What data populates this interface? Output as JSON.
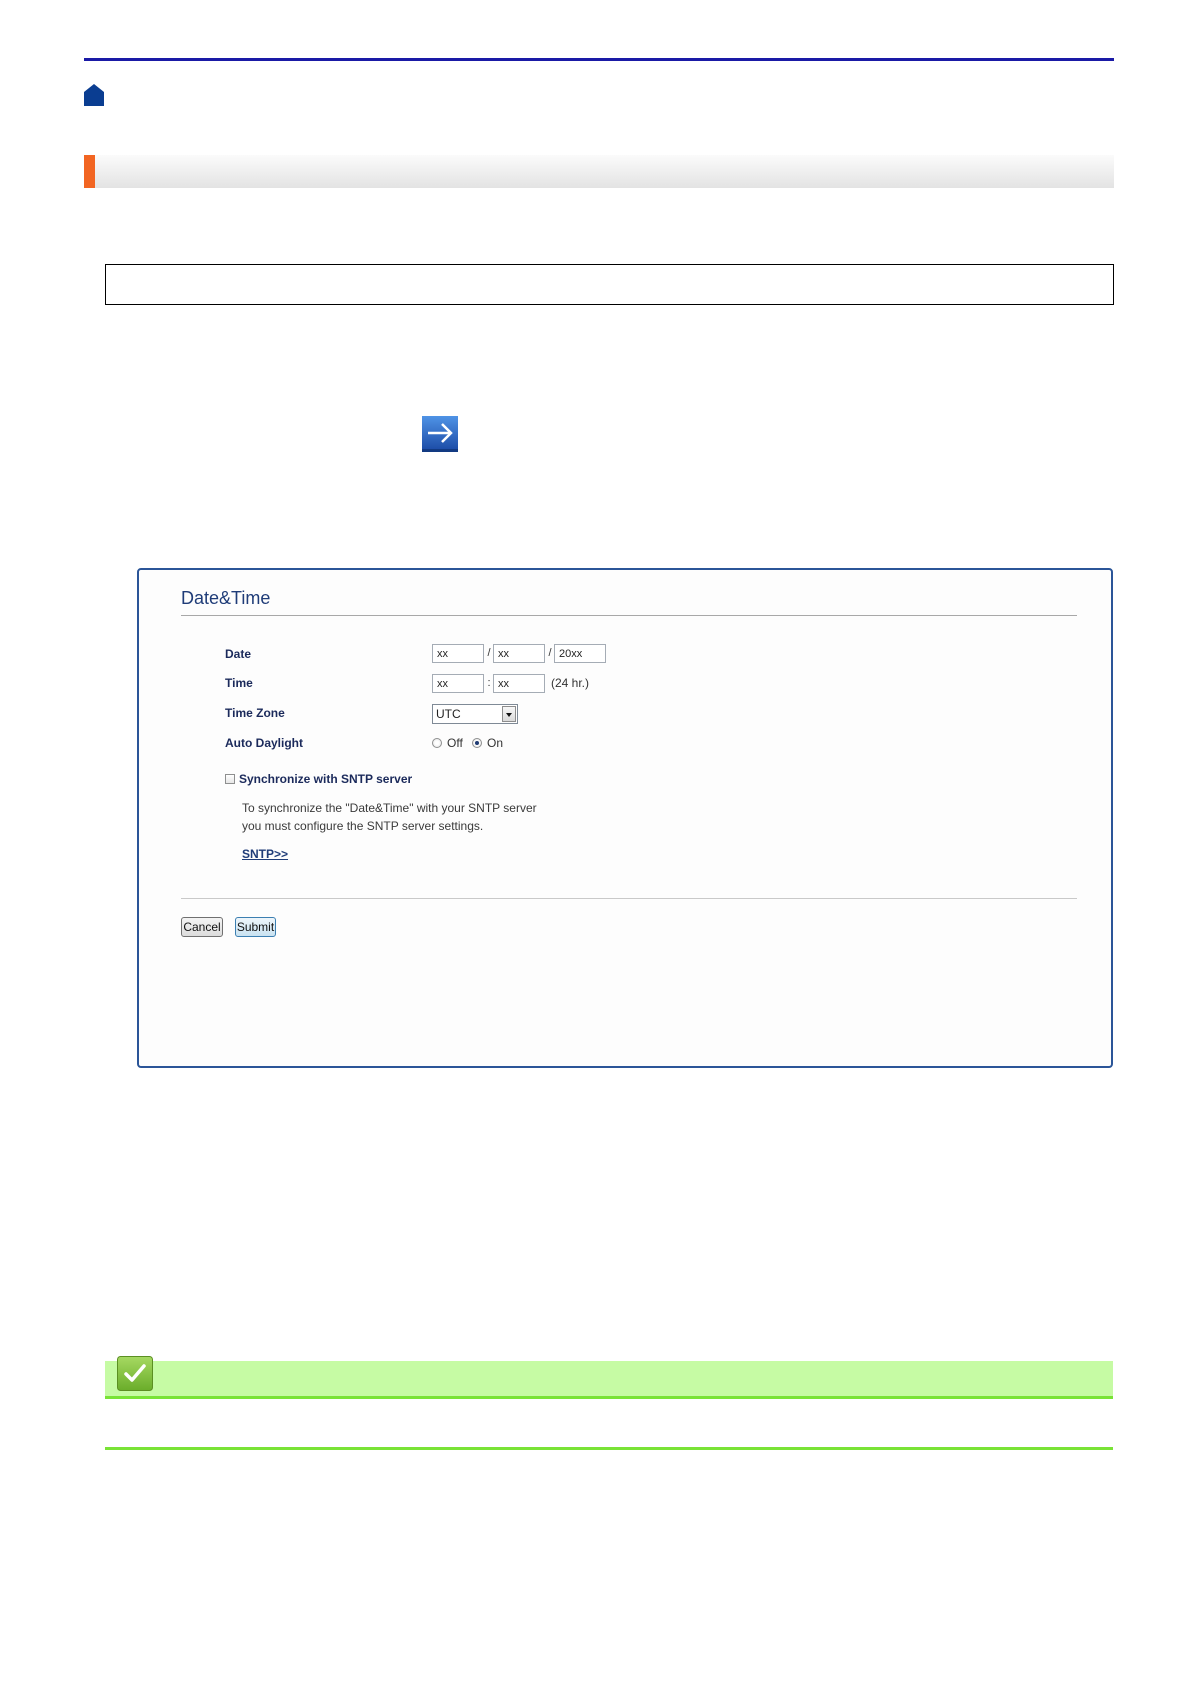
{
  "colors": {
    "rule_blue": "#1a1aa6",
    "heading_orange": "#f26522",
    "screenshot_border": "#2b5598",
    "screenshot_title": "#1f3c78",
    "label_navy": "#1b2a5b",
    "note_green_bg": "#c6fba4",
    "note_green_line": "#79e336"
  },
  "icons": {
    "home": "home-icon",
    "next_step": "arrow-right-icon",
    "tip": "checkmark-icon",
    "select_arrow": "chevron-down-icon"
  },
  "screenshot": {
    "title": "Date&Time",
    "date": {
      "label": "Date",
      "month": "xx",
      "day": "xx",
      "year": "20xx",
      "separator_1": "/",
      "separator_2": "/"
    },
    "time": {
      "label": "Time",
      "hour": "xx",
      "minute": "xx",
      "separator": ":",
      "format_hint": "(24 hr.)"
    },
    "time_zone": {
      "label": "Time Zone",
      "value": "UTC"
    },
    "auto_daylight": {
      "label": "Auto Daylight",
      "options": [
        {
          "label": "Off",
          "checked": false
        },
        {
          "label": "On",
          "checked": true
        }
      ]
    },
    "sntp": {
      "checkbox_label": "Synchronize with SNTP server",
      "checked": false,
      "note_lines": [
        "To synchronize the \"Date&Time\" with your SNTP server",
        "you must configure the SNTP server settings."
      ],
      "link_label": "SNTP>>"
    },
    "buttons": {
      "cancel": "Cancel",
      "submit": "Submit"
    }
  }
}
